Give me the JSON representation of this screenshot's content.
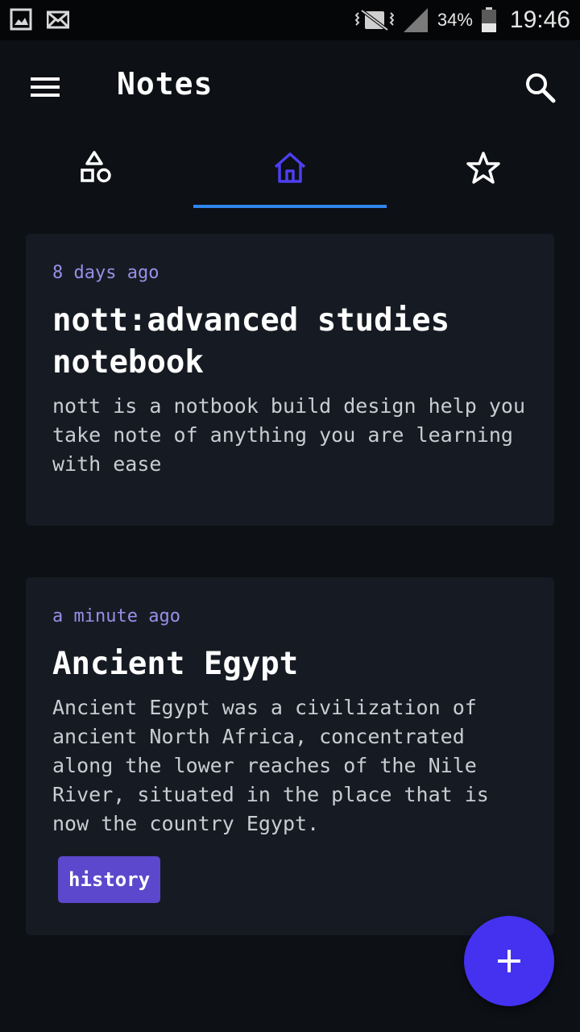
{
  "status_bar": {
    "icons_left": [
      "gallery-icon",
      "mail-icon"
    ],
    "icons_right": [
      "vibrate-mute-icon",
      "signal-icon",
      "battery-icon"
    ],
    "battery_percent": "34%",
    "time": "19:46"
  },
  "app_bar": {
    "title": "Notes",
    "menu_icon": "hamburger-menu-icon",
    "search_icon": "search-icon"
  },
  "tabs": [
    {
      "icon": "shapes-icon",
      "selected": false
    },
    {
      "icon": "home-icon",
      "selected": true
    },
    {
      "icon": "star-icon",
      "selected": false
    }
  ],
  "notes": [
    {
      "time": "8 days ago",
      "title": "nott:advanced studies notebook",
      "body": "nott is a notbook build design help you take note of anything you are learning with ease",
      "tags": []
    },
    {
      "time": "a minute ago",
      "title": "Ancient Egypt",
      "body": "Ancient Egypt was a civilization of ancient North Africa, concentrated along the lower reaches of the Nile River, situated in the place that is now the country Egypt.",
      "tags": [
        "history"
      ]
    }
  ],
  "fab": {
    "icon": "plus-icon"
  },
  "colors": {
    "background": "#0d1015",
    "card": "#161b23",
    "accent_purple": "#4432f0",
    "timestamp": "#9a8ee8",
    "tab_indicator": "#2f86ee",
    "tag": "#5b48cc",
    "home_icon": "#4d3ff0"
  }
}
